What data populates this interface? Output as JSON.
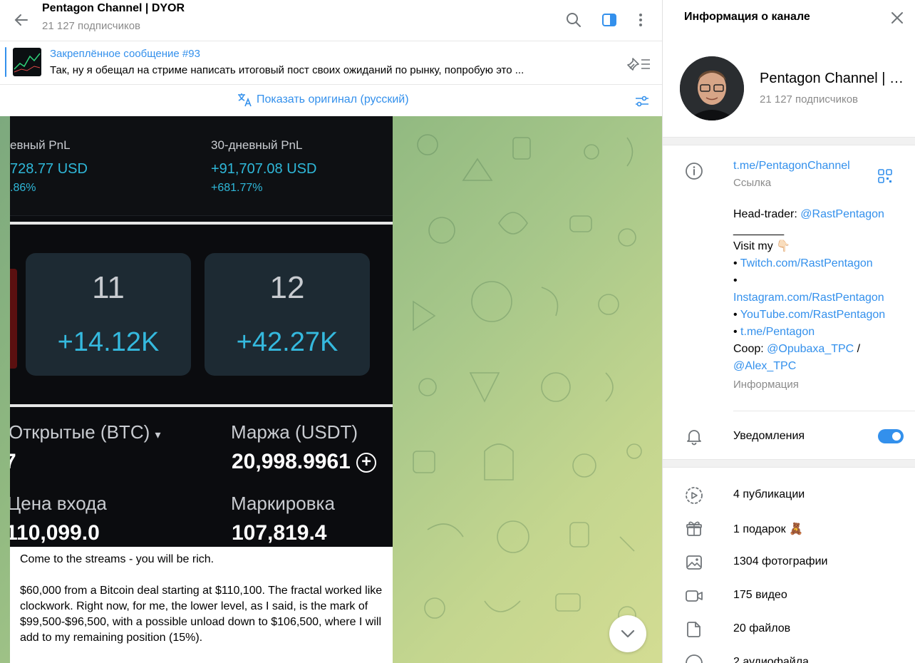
{
  "chat": {
    "title": "Pentagon Channel | DYOR",
    "subscribers": "21 127 подписчиков",
    "pinned": {
      "title": "Закреплённое сообщение #93",
      "text": "Так, ну я обещал на стриме написать итоговый пост своих ожиданий по рынку, попробую это ..."
    },
    "translate_label": "Показать оригинал (русский)"
  },
  "message": {
    "screenshot": {
      "pnl_left_label": "евный PnL",
      "pnl_left_value": "728.77 USD",
      "pnl_left_pct": ".86%",
      "pnl_right_label": "30-дневный PnL",
      "pnl_right_value": "+91,707.08 USD",
      "pnl_right_pct": "+681.77%",
      "day1_num": "11",
      "day1_val": "+14.12K",
      "day2_num": "12",
      "day2_val": "+42.27K",
      "open_label": "Открытые (BTC)",
      "open_value": "7",
      "margin_label": "Маржа (USDT)",
      "margin_value": "20,998.9961",
      "entry_label": "Цена входа",
      "entry_value": "110,099.0",
      "mark_label": "Маркировка",
      "mark_value": "107,819.4"
    },
    "text_p1": "Come to the streams - you will be rich.",
    "text_p2": "$60,000 from a Bitcoin deal starting at $110,100. The fractal worked like clockwork. Right now, for me, the lower level, as I said, is the mark of $99,500-$96,500, with a possible unload down to $106,500, where I will add to my remaining position (15%)."
  },
  "panel": {
    "title": "Информация о канале",
    "name": "Pentagon Channel | DYOR",
    "subscribers": "21 127 подписчиков",
    "link": "t.me/PentagonChannel",
    "link_sub": "Ссылка",
    "head_trader_prefix": "Head-trader: ",
    "head_trader_link": "@RastPentagon",
    "underline": "________",
    "visit_prefix": "Visit my ",
    "visit_emoji": "👇🏻",
    "bullet": "• ",
    "twitch": "Twitch.com/RastPentagon",
    "instagram": "Instagram.com/RastPentagon",
    "youtube": "YouTube.com/RastPentagon",
    "tme": "t.me/Pentagon",
    "coop_prefix": "Coop: ",
    "coop_link1": "@Opubaxa_TPC",
    "coop_sep": " /",
    "coop_link2": "@Alex_TPC",
    "info_sub": "Информация",
    "notifications": "Уведомления",
    "notifications_on": true,
    "media": [
      {
        "label": "4 публикации"
      },
      {
        "label": "1 подарок",
        "emoji": "🧸"
      },
      {
        "label": "1304 фотографии"
      },
      {
        "label": "175 видео"
      },
      {
        "label": "20 файлов"
      },
      {
        "label": "2 аудиофайла"
      }
    ],
    "accent_color": "#3390ec"
  }
}
